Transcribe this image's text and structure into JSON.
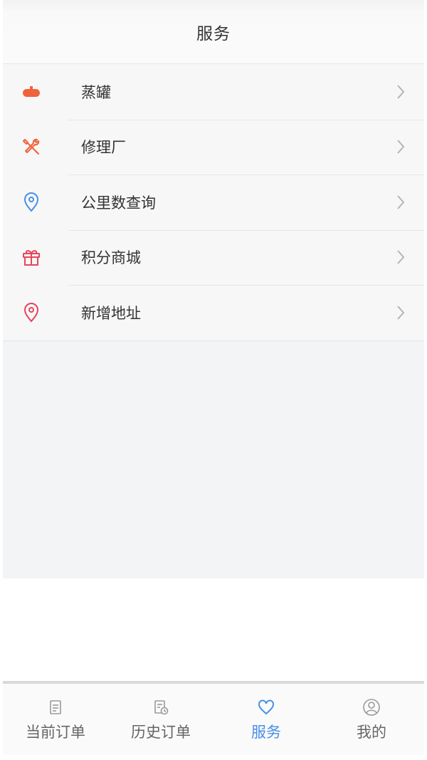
{
  "header": {
    "title": "服务"
  },
  "menu": {
    "items": [
      {
        "label": "蒸罐",
        "icon": "tank-icon",
        "color": "#f0623a"
      },
      {
        "label": "修理厂",
        "icon": "tools-icon",
        "color": "#f0623a"
      },
      {
        "label": "公里数查询",
        "icon": "location-pin-icon",
        "color": "#4a8fe8"
      },
      {
        "label": "积分商城",
        "icon": "gift-icon",
        "color": "#e8455a"
      },
      {
        "label": "新增地址",
        "icon": "location-pin-icon",
        "color": "#e8455a"
      }
    ]
  },
  "tabbar": {
    "tabs": [
      {
        "label": "当前订单",
        "icon": "clipboard-icon"
      },
      {
        "label": "历史订单",
        "icon": "history-icon"
      },
      {
        "label": "服务",
        "icon": "heart-icon",
        "active": true
      },
      {
        "label": "我的",
        "icon": "user-icon"
      }
    ],
    "active_color": "#4a8fe8",
    "inactive_color": "#666666"
  }
}
